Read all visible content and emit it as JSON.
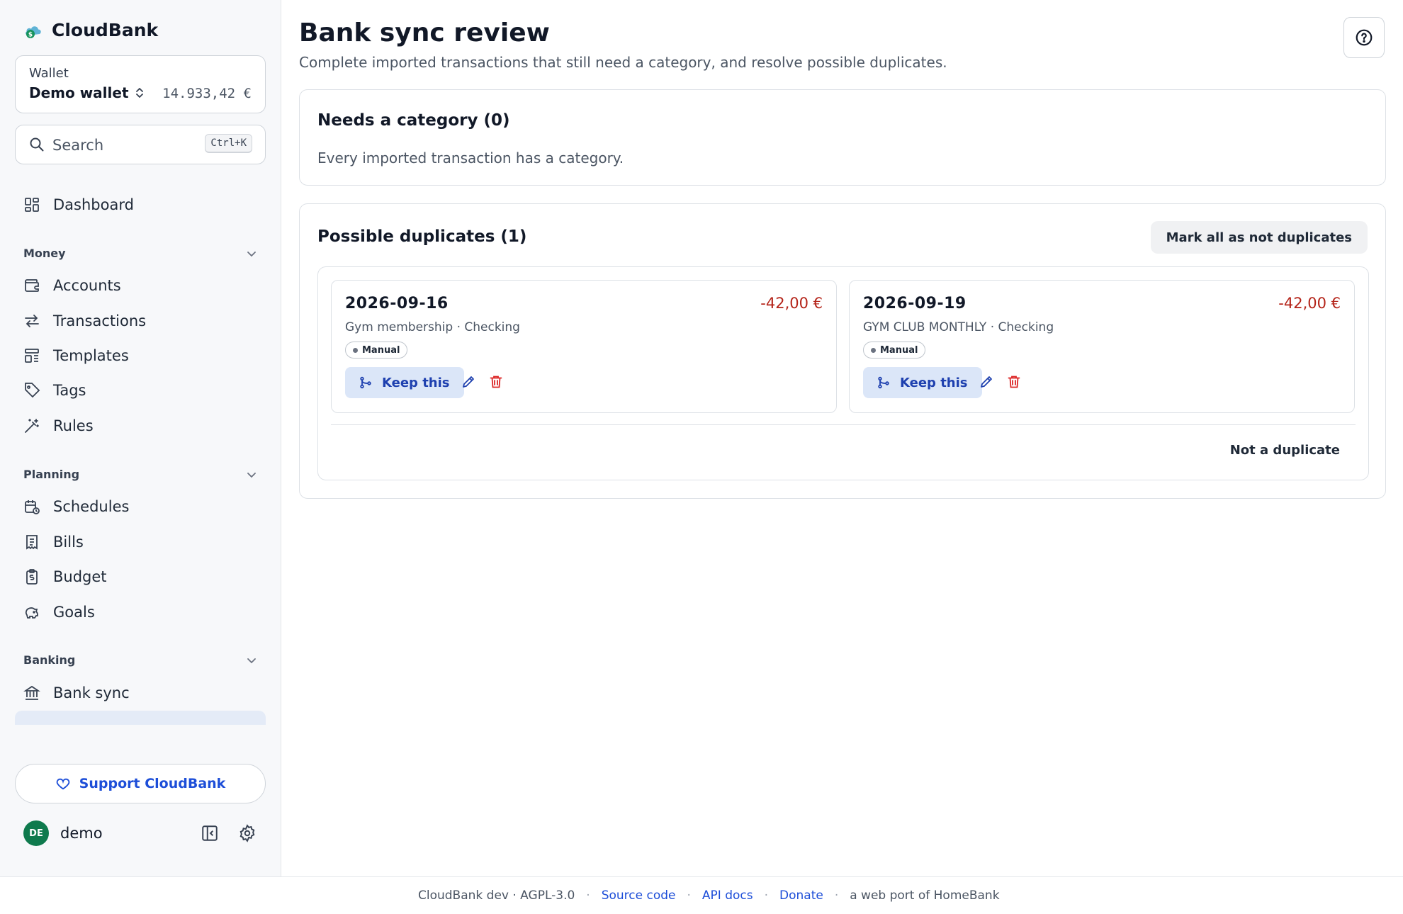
{
  "app": {
    "name": "CloudBank"
  },
  "wallet": {
    "label": "Wallet",
    "name": "Demo wallet",
    "balance": "14.933,42 €"
  },
  "search": {
    "placeholder": "Search",
    "shortcut": "Ctrl+K"
  },
  "nav": {
    "dashboard": "Dashboard",
    "money": {
      "title": "Money",
      "items": [
        "Accounts",
        "Transactions",
        "Templates",
        "Tags",
        "Rules"
      ]
    },
    "planning": {
      "title": "Planning",
      "items": [
        "Schedules",
        "Bills",
        "Budget",
        "Goals"
      ]
    },
    "banking": {
      "title": "Banking",
      "items": [
        "Bank sync"
      ]
    }
  },
  "support_label": "Support CloudBank",
  "user": {
    "initials": "DE",
    "name": "demo"
  },
  "page": {
    "title": "Bank sync review",
    "subtitle": "Complete imported transactions that still need a category, and resolve possible duplicates."
  },
  "needs_category": {
    "title": "Needs a category (0)",
    "empty_text": "Every imported transaction has a category."
  },
  "duplicates": {
    "title": "Possible duplicates (1)",
    "mark_all_label": "Mark all as not duplicates",
    "not_duplicate_label": "Not a duplicate",
    "keep_label": "Keep this",
    "transactions": [
      {
        "date": "2026-09-16",
        "amount": "-42,00 €",
        "description": "Gym membership · Checking",
        "badge": "Manual"
      },
      {
        "date": "2026-09-19",
        "amount": "-42,00 €",
        "description": "GYM CLUB MONTHLY · Checking",
        "badge": "Manual"
      }
    ]
  },
  "footer": {
    "version": "CloudBank dev · AGPL-3.0",
    "source_link": "Source code",
    "api_link": "API docs",
    "donate_link": "Donate",
    "port_text": "a web port of HomeBank"
  },
  "colors": {
    "accent": "#1d4ed8",
    "negative_amount": "#b42318",
    "avatar": "#0f7a4d",
    "active_nav": "#e4ebf7"
  }
}
